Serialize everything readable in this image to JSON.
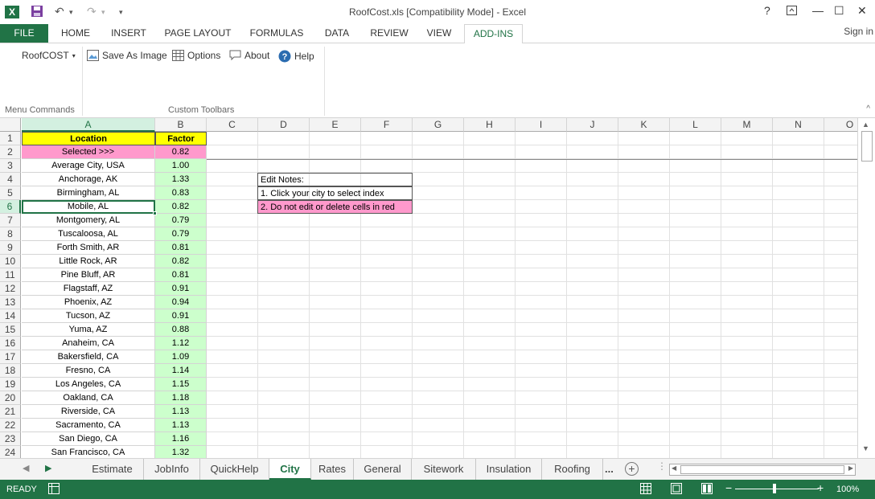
{
  "title": "RoofCost.xls  [Compatibility Mode] - Excel",
  "window": {
    "help": "?",
    "minimize": "—",
    "maximize": "☐",
    "close": "✕"
  },
  "qat": {
    "save": "💾",
    "undo": "↶",
    "redo": "↷",
    "more": "▾"
  },
  "tabs": [
    "FILE",
    "HOME",
    "INSERT",
    "PAGE LAYOUT",
    "FORMULAS",
    "DATA",
    "REVIEW",
    "VIEW",
    "ADD-INS"
  ],
  "signin": "Sign in",
  "ribbon": {
    "roofcost": "RoofCOST",
    "save_as_image": "Save As Image",
    "options": "Options",
    "about": "About",
    "help": "Help",
    "group_menu": "Menu Commands",
    "group_toolbars": "Custom Toolbars"
  },
  "columns": [
    "A",
    "B",
    "C",
    "D",
    "E",
    "F",
    "G",
    "H",
    "I",
    "J",
    "K",
    "L",
    "M",
    "N",
    "O"
  ],
  "header_row": {
    "location": "Location",
    "factor": "Factor"
  },
  "selected_row": {
    "label": "Selected >>>",
    "value": "0.82"
  },
  "cities": [
    {
      "city": "Average City, USA",
      "factor": "1.00"
    },
    {
      "city": "Anchorage, AK",
      "factor": "1.33"
    },
    {
      "city": "Birmingham, AL",
      "factor": "0.83"
    },
    {
      "city": "Mobile, AL",
      "factor": "0.82"
    },
    {
      "city": "Montgomery, AL",
      "factor": "0.79"
    },
    {
      "city": "Tuscaloosa, AL",
      "factor": "0.79"
    },
    {
      "city": "Forth Smith, AR",
      "factor": "0.81"
    },
    {
      "city": "Little Rock, AR",
      "factor": "0.82"
    },
    {
      "city": "Pine Bluff, AR",
      "factor": "0.81"
    },
    {
      "city": "Flagstaff, AZ",
      "factor": "0.91"
    },
    {
      "city": "Phoenix, AZ",
      "factor": "0.94"
    },
    {
      "city": "Tucson, AZ",
      "factor": "0.91"
    },
    {
      "city": "Yuma, AZ",
      "factor": "0.88"
    },
    {
      "city": "Anaheim, CA",
      "factor": "1.12"
    },
    {
      "city": "Bakersfield, CA",
      "factor": "1.09"
    },
    {
      "city": "Fresno, CA",
      "factor": "1.14"
    },
    {
      "city": "Los Angeles, CA",
      "factor": "1.15"
    },
    {
      "city": "Oakland, CA",
      "factor": "1.18"
    },
    {
      "city": "Riverside, CA",
      "factor": "1.13"
    },
    {
      "city": "Sacramento, CA",
      "factor": "1.13"
    },
    {
      "city": "San Diego, CA",
      "factor": "1.16"
    },
    {
      "city": "San Francisco, CA",
      "factor": "1.32"
    }
  ],
  "notes": {
    "title": "Edit Notes:",
    "line1": "1. Click your city to select index",
    "line2": "2. Do not edit or delete cells in red"
  },
  "sheets": [
    "Estimate",
    "JobInfo",
    "QuickHelp",
    "City",
    "Rates",
    "General",
    "Sitework",
    "Insulation",
    "Roofing"
  ],
  "sheet_more": "...",
  "status": {
    "ready": "READY",
    "zoom": "100%"
  },
  "colors": {
    "excel_green": "#217346",
    "header_yellow": "#ffff00",
    "pink": "#ff99cc",
    "light_green": "#ccffcc"
  }
}
